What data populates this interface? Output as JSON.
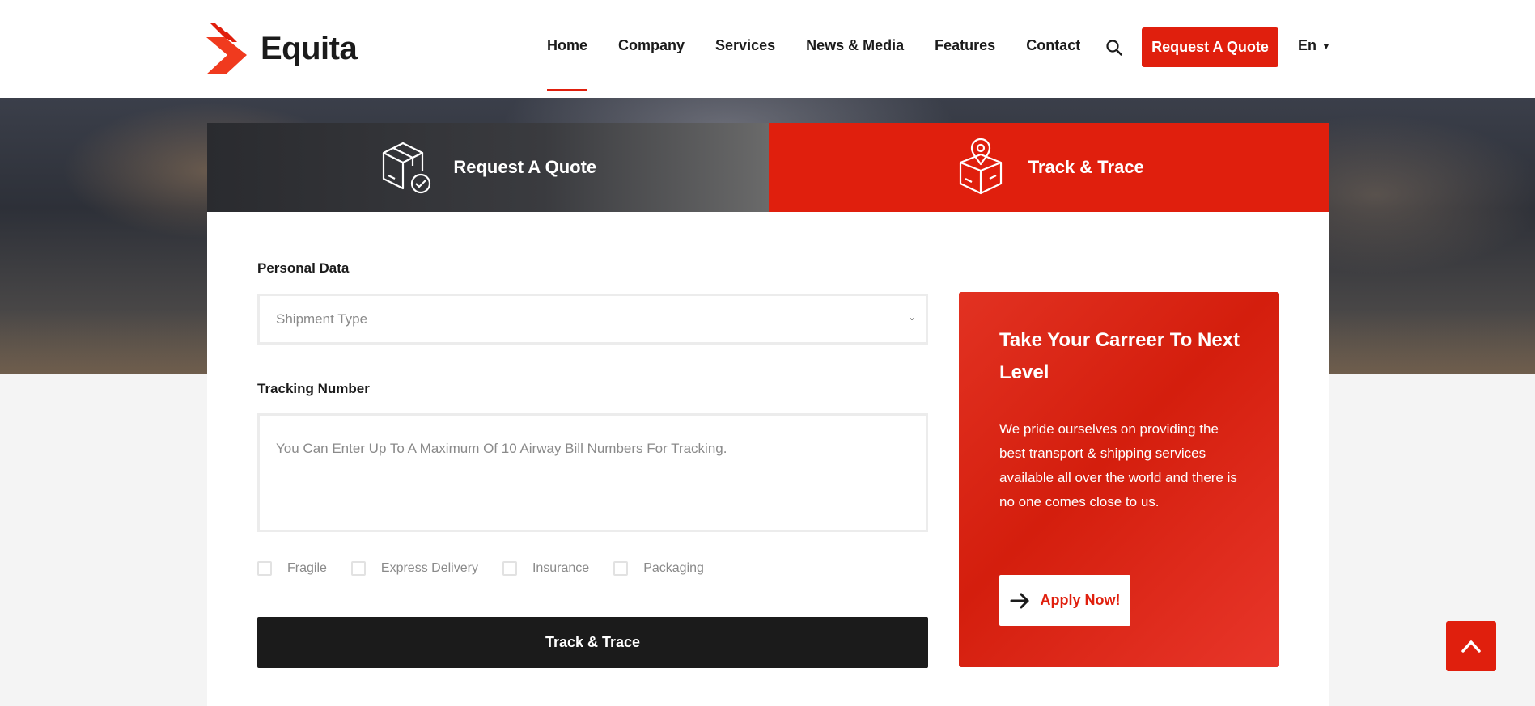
{
  "brand": {
    "name": "Equita",
    "accent": "#e01f0d"
  },
  "nav": {
    "items": [
      {
        "label": "Home",
        "active": true
      },
      {
        "label": "Company",
        "active": false
      },
      {
        "label": "Services",
        "active": false
      },
      {
        "label": "News & Media",
        "active": false
      },
      {
        "label": "Features",
        "active": false
      },
      {
        "label": "Contact",
        "active": false
      }
    ],
    "search_icon": "search-icon",
    "quote_button": "Request A Quote",
    "language": "En"
  },
  "tabs": [
    {
      "label": "Request A Quote",
      "icon": "box-check-icon",
      "active": false
    },
    {
      "label": "Track & Trace",
      "icon": "box-location-icon",
      "active": true
    }
  ],
  "form": {
    "personal_label": "Personal Data",
    "shipment_placeholder": "Shipment Type",
    "tracking_label": "Tracking Number",
    "tracking_placeholder": "You Can Enter Up To A Maximum Of 10 Airway Bill Numbers For Tracking.",
    "checkboxes": [
      {
        "label": "Fragile",
        "checked": false
      },
      {
        "label": "Express Delivery",
        "checked": false
      },
      {
        "label": "Insurance",
        "checked": false
      },
      {
        "label": "Packaging",
        "checked": false
      }
    ],
    "submit": "Track & Trace"
  },
  "promo": {
    "title": "Take Your Carreer To Next Level",
    "text": "We pride ourselves on providing the best transport & shipping services available all over the world and there is no one comes close to us.",
    "button": "Apply Now!"
  },
  "back_to_top_icon": "chevron-up-icon"
}
